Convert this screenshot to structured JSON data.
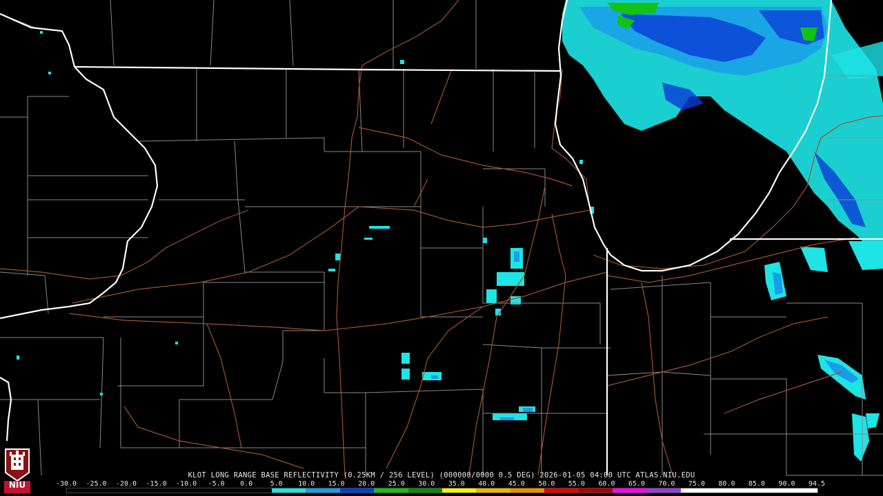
{
  "header": {
    "caption": "KLOT LONG RANGE BASE REFLECTIVITY (0.25KM / 256 LEVEL) (000000/0000 0.5 DEG) 2026-01-05 04:00 UTC  ATLAS.NIU.EDU"
  },
  "logo": {
    "text": "NIU"
  },
  "scale": {
    "labels": [
      "-30.0",
      "-25.0",
      "-20.0",
      "-15.0",
      "-10.0",
      "-5.0",
      "0.0",
      "5.0",
      "10.0",
      "15.0",
      "20.0",
      "25.0",
      "30.0",
      "35.0",
      "40.0",
      "45.0",
      "50.0",
      "55.0",
      "60.0",
      "65.0",
      "70.0",
      "75.0",
      "80.0",
      "85.0",
      "90.0",
      "94.5"
    ],
    "colors": [
      "#000000",
      "#000000",
      "#000000",
      "#000000",
      "#000000",
      "#000000",
      "#1ee4e6",
      "#1a9de8",
      "#0a3cd6",
      "#13c213",
      "#0c8a0c",
      "#f5f500",
      "#e6b800",
      "#f08c00",
      "#e60000",
      "#b00000",
      "#ff00ff",
      "#9a3fd6",
      "#ffffff",
      "#ffffff",
      "#ffffff",
      "#ffffff"
    ]
  },
  "colors": {
    "state_border": "#ffffff",
    "county_border": "#8a8a8a",
    "highway": "#a0522d",
    "light_cyan": "#1ee4e6",
    "mid_blue": "#1a9de8",
    "deep_blue": "#0a3cd6",
    "green": "#13c213"
  }
}
